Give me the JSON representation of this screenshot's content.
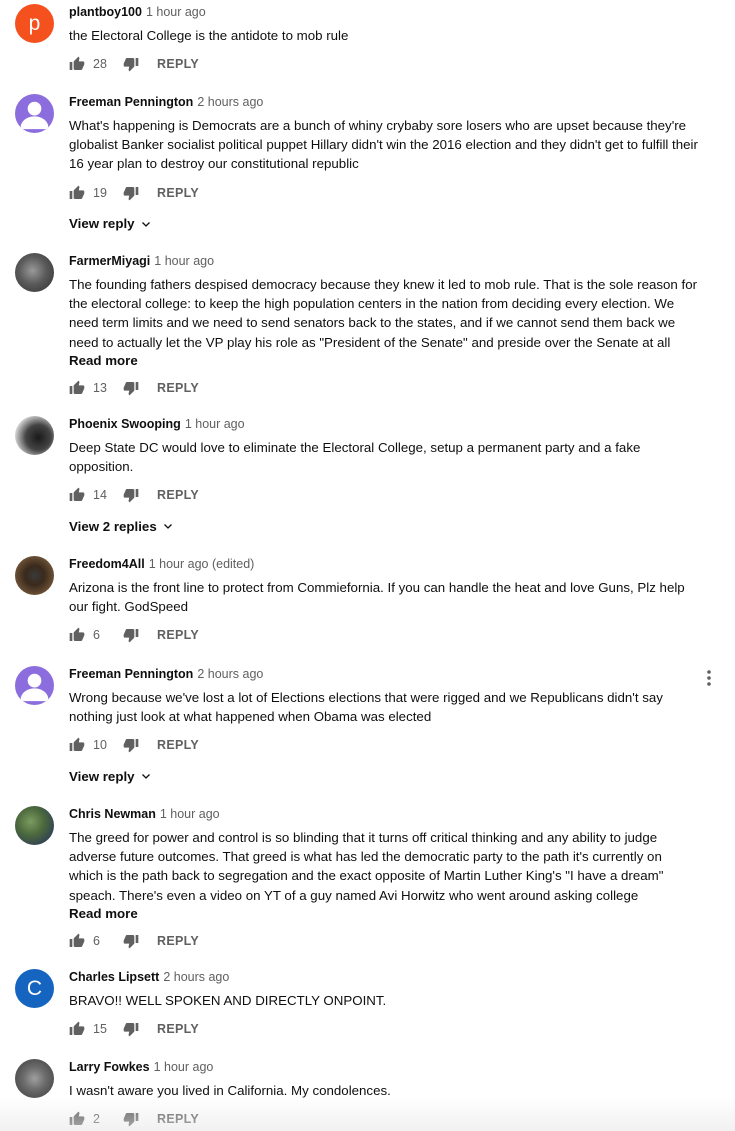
{
  "comments": [
    {
      "author": "plantboy100",
      "time": "1 hour ago",
      "avatar_letter": "p",
      "text": "the Electoral College is the antidote to mob rule",
      "likes": "28",
      "reply": "REPLY"
    },
    {
      "author": "Freeman Pennington",
      "time": "2 hours ago",
      "text": "What's happening is Democrats are a bunch of whiny crybaby sore losers who are upset because they're globalist Banker socialist political puppet Hillary didn't win the 2016 election and they didn't get to fulfill their 16 year plan to destroy our constitutional republic",
      "likes": "19",
      "reply": "REPLY",
      "view_replies": "View reply"
    },
    {
      "author": "FarmerMiyagi",
      "time": "1 hour ago",
      "text": "The founding fathers despised democracy because they knew it led to mob rule.  That is the sole reason for the electoral college: to keep the high population centers in the nation from deciding every election. We need term limits and we need to send senators back to the states, and if we cannot send them back we need to actually let the VP play his role as \"President of the Senate\" and preside over the Senate at all",
      "read_more": "Read more",
      "likes": "13",
      "reply": "REPLY"
    },
    {
      "author": "Phoenix Swooping",
      "time": "1 hour ago",
      "text": "Deep State DC would love to eliminate the Electoral College, setup a permanent party and a fake opposition.",
      "likes": "14",
      "reply": "REPLY",
      "view_replies": "View 2 replies"
    },
    {
      "author": "Freedom4All",
      "time": "1 hour ago (edited)",
      "text": "Arizona is the front line to protect from Commiefornia. If you can handle the heat and love Guns, Plz help our fight. GodSpeed",
      "likes": "6",
      "reply": "REPLY"
    },
    {
      "author": "Freeman Pennington",
      "time": "2 hours ago",
      "text": "Wrong because we've lost a lot of Elections elections that were rigged and we Republicans didn't say nothing just look at what happened when Obama was elected",
      "likes": "10",
      "reply": "REPLY",
      "view_replies": "View reply"
    },
    {
      "author": "Chris Newman",
      "time": "1 hour ago",
      "text": "The greed for power and control is so blinding that it turns off critical thinking and any ability to judge adverse future outcomes. That greed is what has led the democratic party to the path it's currently on which is the path back to segregation and the exact opposite of Martin Luther King's \"I have a dream\" speach. There's even a video on YT of a guy named Avi Horwitz who went around asking college",
      "read_more": "Read more",
      "likes": "6",
      "reply": "REPLY"
    },
    {
      "author": "Charles Lipsett",
      "time": "2 hours ago",
      "avatar_letter": "C",
      "text": "BRAVO!! WELL SPOKEN AND DIRECTLY ONPOINT.",
      "likes": "15",
      "reply": "REPLY"
    },
    {
      "author": "Larry Fowkes",
      "time": "1 hour ago",
      "text": "I wasn't aware you lived in California. My condolences.",
      "likes": "2",
      "reply": "REPLY"
    }
  ],
  "icons": {
    "like": "thumbs-up-icon",
    "dislike": "thumbs-down-icon",
    "expand": "chevron-down-icon",
    "menu": "more-vert-icon"
  },
  "colors": {
    "avatar_p": "#f4511e",
    "avatar_c": "#1565c0",
    "avatar_default": "#8c6dde",
    "secondary_text": "#606060"
  }
}
